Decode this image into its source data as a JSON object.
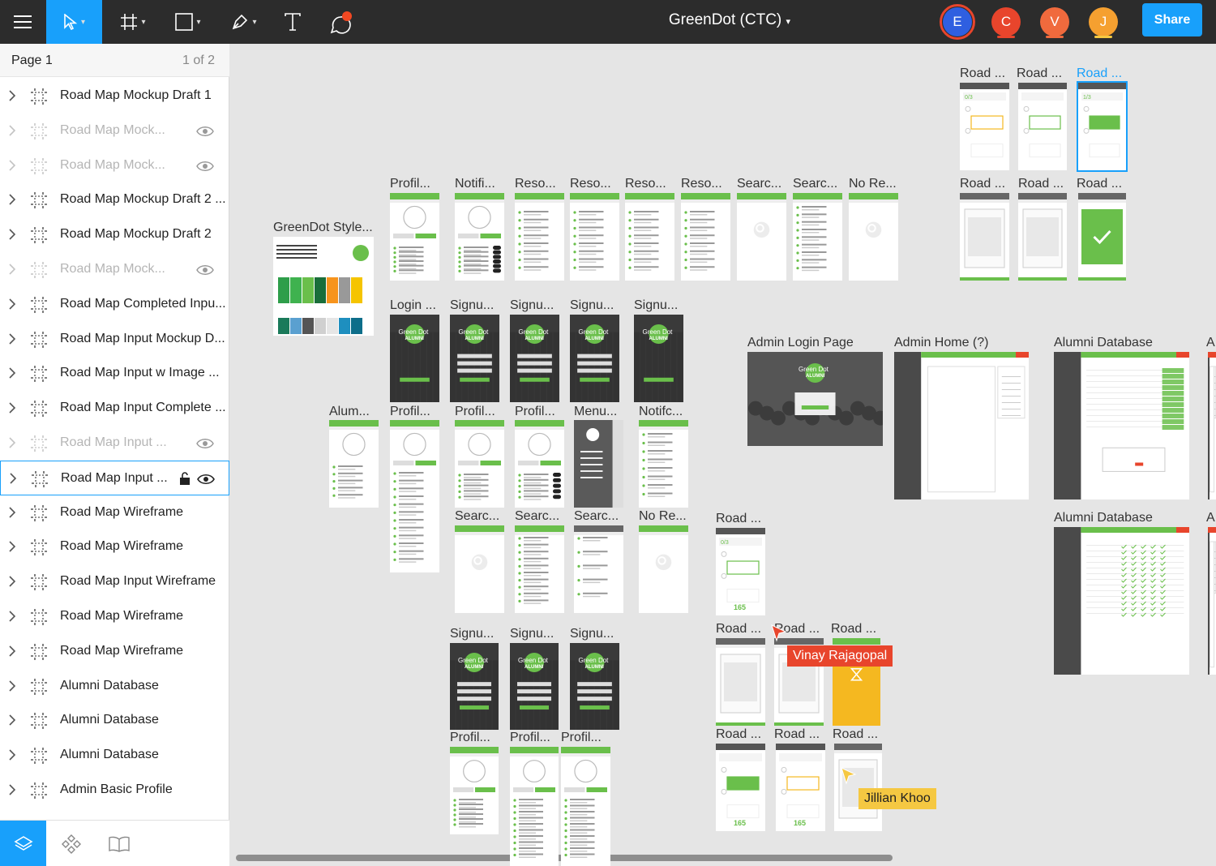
{
  "toolbar": {
    "file_title": "GreenDot (CTC)",
    "share_label": "Share",
    "accent": "#18a0fb",
    "tools": [
      "menu-icon",
      "move-tool-icon",
      "frame-tool-icon",
      "shape-tool-icon",
      "pen-tool-icon",
      "text-tool-icon",
      "comment-tool-icon"
    ],
    "collaborators": [
      {
        "initial": "E",
        "color": "#2f5fe0"
      },
      {
        "initial": "C",
        "color": "#e8452c"
      },
      {
        "initial": "V",
        "color": "#f06a3d"
      },
      {
        "initial": "J",
        "color": "#f5a030"
      }
    ]
  },
  "sidebar": {
    "page_name": "Page 1",
    "page_count": "1 of 2",
    "layers": [
      {
        "label": "Road Map Mockup Draft 1",
        "hidden": false
      },
      {
        "label": "Road Map Mock...",
        "hidden": true
      },
      {
        "label": "Road Map Mock...",
        "hidden": true
      },
      {
        "label": "Road Map Mockup Draft 2 ...",
        "hidden": false
      },
      {
        "label": "Road Map Mockup Draft 2",
        "hidden": false
      },
      {
        "label": "Road Map Mock...",
        "hidden": true
      },
      {
        "label": "Road Map Completed Inpu...",
        "hidden": false
      },
      {
        "label": "Road Map Input Mockup D...",
        "hidden": false
      },
      {
        "label": "Road Map Input w Image ...",
        "hidden": false
      },
      {
        "label": "Road Map Input Complete ...",
        "hidden": false
      },
      {
        "label": "Road Map Input ...",
        "hidden": true
      },
      {
        "label": "Road Map Input ...",
        "hidden": false,
        "selected": true,
        "locked": true
      },
      {
        "label": "Road Map Wireframe",
        "hidden": false
      },
      {
        "label": "Road Map Wireframe",
        "hidden": false
      },
      {
        "label": "Road Map Input Wireframe",
        "hidden": false
      },
      {
        "label": "Road Map Wireframe",
        "hidden": false
      },
      {
        "label": "Road Map Wireframe",
        "hidden": false
      },
      {
        "label": "Alumni Database",
        "hidden": false
      },
      {
        "label": "Alumni Database",
        "hidden": false
      },
      {
        "label": "Alumni Database",
        "hidden": false
      },
      {
        "label": "Admin Basic Profile",
        "hidden": false
      }
    ],
    "bottom_tabs": [
      "layers-icon",
      "components-icon",
      "library-icon"
    ]
  },
  "canvas": {
    "frame_labels": {
      "style": "GreenDot Style...",
      "admin_login": "Admin Login Page",
      "admin_home": "Admin Home (?)",
      "alumni_db_1": "Alumni Database",
      "alumni_db_2": "Alumni Database",
      "road": "Road ...",
      "road_selected": "Road ...",
      "profil": "Profil...",
      "notifi": "Notifi...",
      "reso": "Reso...",
      "searc": "Searc...",
      "no_re": "No Re...",
      "login": "Login ...",
      "signu": "Signu...",
      "alum": "Alum...",
      "menu": "Menu...",
      "notifc": "Notifc...",
      "a": "A"
    },
    "phone_texts": {
      "green_dot": "Green Dot",
      "alumni": "ALUMNI",
      "progress_count": "165",
      "progress_small": "0/3",
      "progress_small_2": "1/3"
    },
    "cursors": [
      {
        "name": "Vinay Rajagopal",
        "color": "#e8452c",
        "text_color": "#ffffff"
      },
      {
        "name": "Jillian Khoo",
        "color": "#f5c842",
        "text_color": "#222222"
      }
    ],
    "brand_green": "#6abf4b"
  }
}
